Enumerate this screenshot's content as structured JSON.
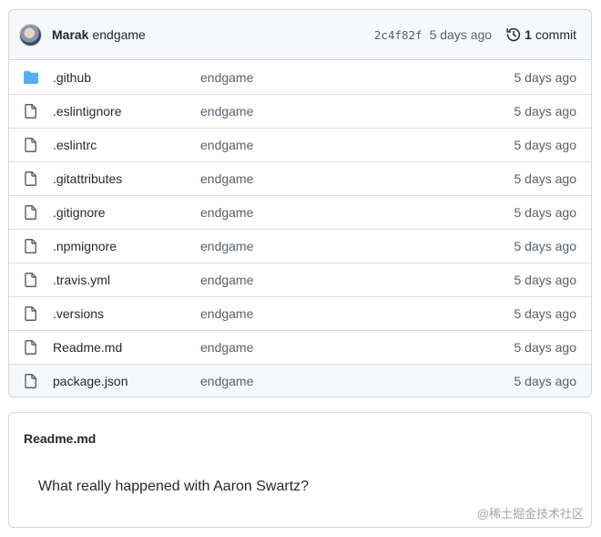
{
  "commit": {
    "author": "Marak",
    "message": "endgame",
    "sha": "2c4f82f",
    "age": "5 days ago",
    "count": "1",
    "count_label": "commit"
  },
  "files": [
    {
      "name": ".github",
      "type": "folder",
      "message": "endgame",
      "date": "5 days ago"
    },
    {
      "name": ".eslintignore",
      "type": "file",
      "message": "endgame",
      "date": "5 days ago"
    },
    {
      "name": ".eslintrc",
      "type": "file",
      "message": "endgame",
      "date": "5 days ago"
    },
    {
      "name": ".gitattributes",
      "type": "file",
      "message": "endgame",
      "date": "5 days ago"
    },
    {
      "name": ".gitignore",
      "type": "file",
      "message": "endgame",
      "date": "5 days ago"
    },
    {
      "name": ".npmignore",
      "type": "file",
      "message": "endgame",
      "date": "5 days ago"
    },
    {
      "name": ".travis.yml",
      "type": "file",
      "message": "endgame",
      "date": "5 days ago"
    },
    {
      "name": ".versions",
      "type": "file",
      "message": "endgame",
      "date": "5 days ago"
    },
    {
      "name": "Readme.md",
      "type": "file",
      "message": "endgame",
      "date": "5 days ago"
    },
    {
      "name": "package.json",
      "type": "file",
      "message": "endgame",
      "date": "5 days ago",
      "hovered": true
    }
  ],
  "readme": {
    "title": "Readme.md",
    "body": "What really happened with Aaron Swartz?"
  },
  "watermark": "@稀土掘金技术社区",
  "colors": {
    "folder": "#54aeff",
    "file_icon": "#57606a",
    "border": "#d0d7de"
  }
}
